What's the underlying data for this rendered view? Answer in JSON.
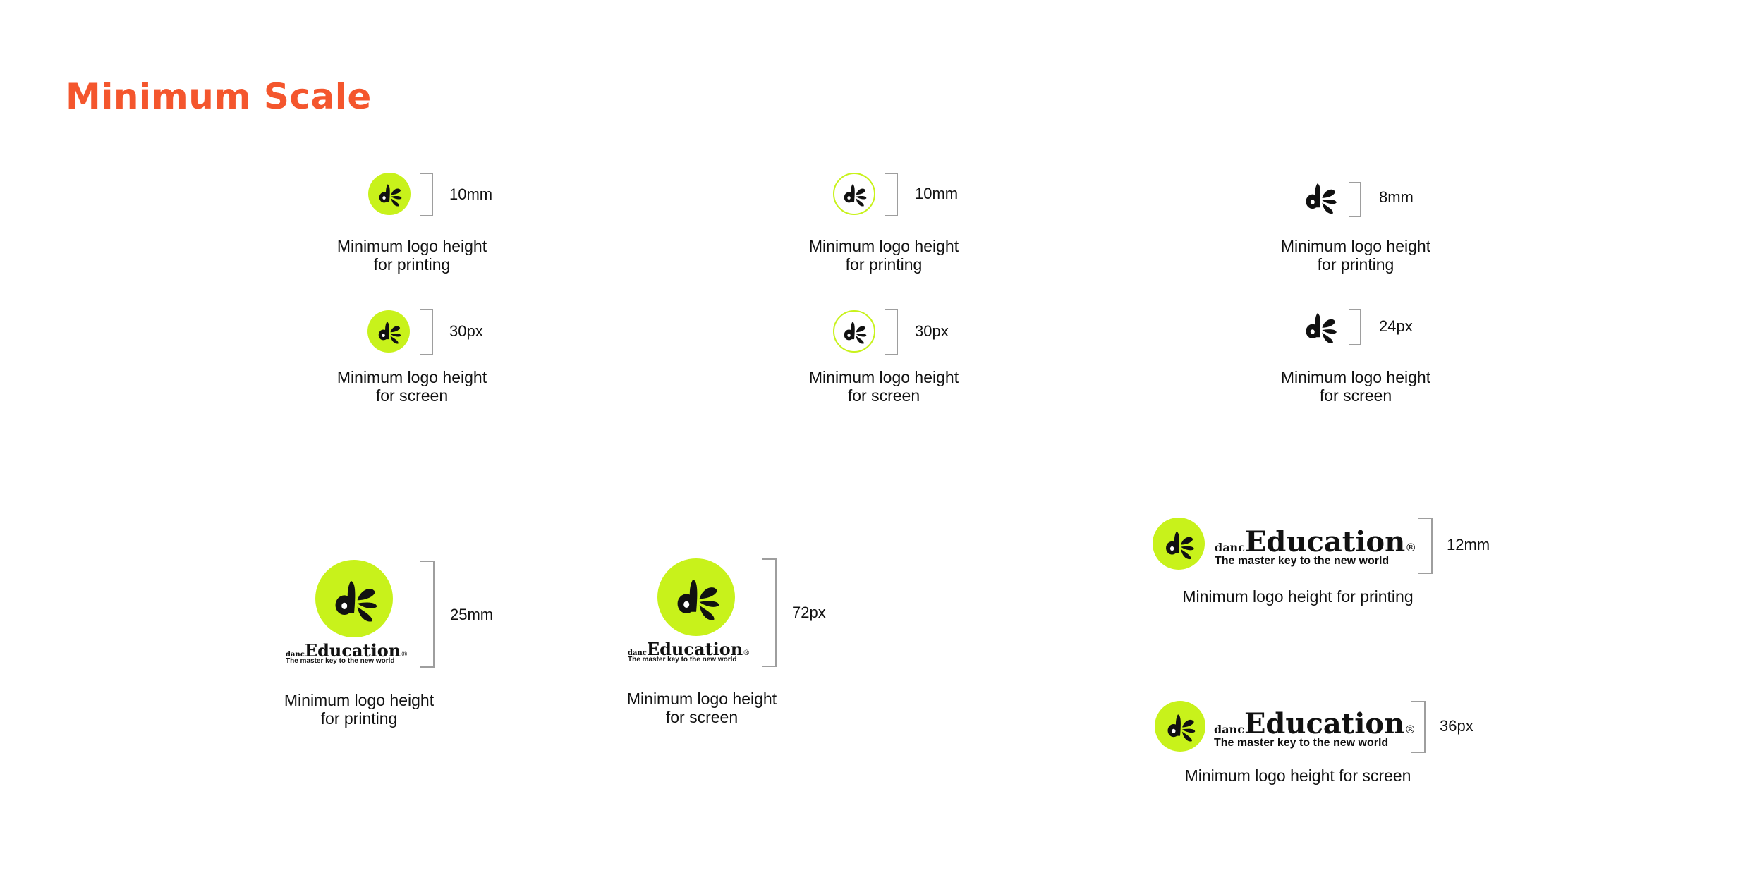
{
  "page": {
    "title": "Minimum Scale"
  },
  "colors": {
    "title": "#f4562d",
    "brand_lime": "#c8f21b",
    "ink": "#111111",
    "bracket": "#9e9e9e"
  },
  "logo": {
    "prefix": "danc",
    "name": "Education",
    "registered": "®",
    "tagline": "The master key to the new world",
    "icon_name": "de-monogram-icon"
  },
  "symbol_only": [
    {
      "variant": "filled",
      "print": {
        "measure": "10mm",
        "caption_line1": "Minimum logo height",
        "caption_line2": "for printing"
      },
      "screen": {
        "measure": "30px",
        "caption_line1": "Minimum logo height",
        "caption_line2": "for screen"
      }
    },
    {
      "variant": "outline",
      "print": {
        "measure": "10mm",
        "caption_line1": "Minimum logo height",
        "caption_line2": "for printing"
      },
      "screen": {
        "measure": "30px",
        "caption_line1": "Minimum logo height",
        "caption_line2": "for screen"
      }
    },
    {
      "variant": "monogram",
      "print": {
        "measure": "8mm",
        "caption_line1": "Minimum logo height",
        "caption_line2": "for printing"
      },
      "screen": {
        "measure": "24px",
        "caption_line1": "Minimum logo height",
        "caption_line2": "for screen"
      }
    }
  ],
  "stacked": [
    {
      "measure": "25mm",
      "caption_line1": "Minimum logo height",
      "caption_line2": "for printing"
    },
    {
      "measure": "72px",
      "caption_line1": "Minimum logo height",
      "caption_line2": "for screen"
    }
  ],
  "horizontal": [
    {
      "measure": "12mm",
      "caption": "Minimum logo height for printing"
    },
    {
      "measure": "36px",
      "caption": "Minimum logo height for screen"
    }
  ]
}
